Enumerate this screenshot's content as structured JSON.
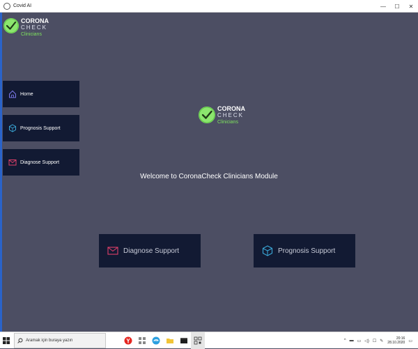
{
  "window": {
    "title": "Covid AI",
    "controls": [
      "—",
      "☐",
      "✕"
    ]
  },
  "logo": {
    "line1": "CORONA",
    "line2": "CHECK",
    "line3": "Clinicians"
  },
  "sidebar": {
    "items": [
      {
        "label": "Home",
        "icon": "home-icon"
      },
      {
        "label": "Prognosis Support",
        "icon": "cube-icon"
      },
      {
        "label": "Diagnose Support",
        "icon": "mail-icon"
      }
    ]
  },
  "main": {
    "welcome": "Welcome to CoronaCheck Clinicians Module",
    "buttons": [
      {
        "label": "Diagnose Support",
        "icon": "mail-icon"
      },
      {
        "label": "Prognosis Support",
        "icon": "cube-icon"
      }
    ]
  },
  "taskbar": {
    "search_placeholder": "Aramak için buraya yazın",
    "time": "20:16",
    "date": "28.10.2020"
  },
  "colors": {
    "background": "#4c4e63",
    "button": "#121a33",
    "logo_green": "#8ce66e",
    "home_icon": "#7b78e8",
    "cube_icon": "#3aa8d8",
    "mail_icon": "#e0406a"
  }
}
